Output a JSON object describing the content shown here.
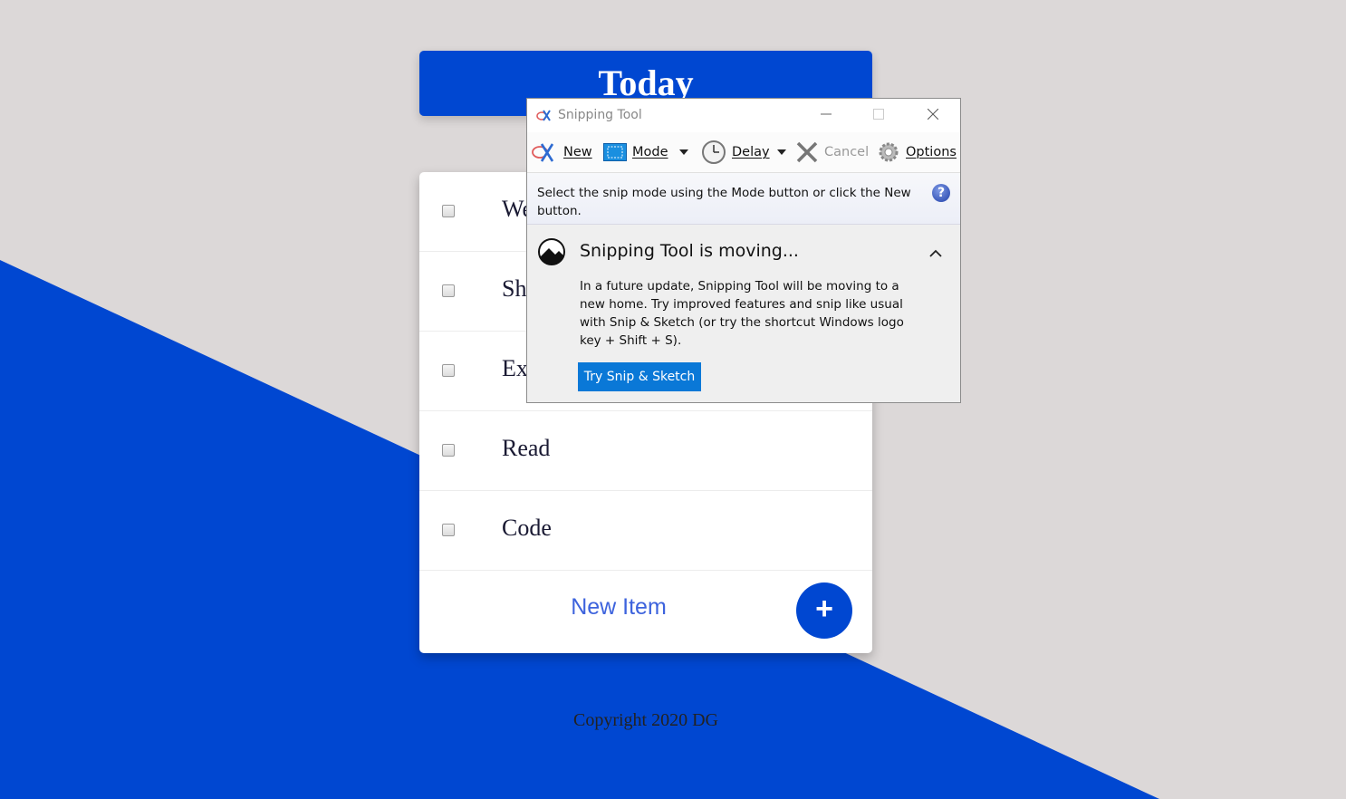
{
  "page": {
    "heading": "Today",
    "todo_items": [
      {
        "label": "We"
      },
      {
        "label": "Sho"
      },
      {
        "label": "Ex"
      },
      {
        "label": "Read"
      },
      {
        "label": "Code"
      }
    ],
    "new_item_label": "New Item",
    "add_button_symbol": "+",
    "copyright": "Copyright 2020 DG",
    "accent_color": "#0047d1",
    "background_color": "#dcd8d8"
  },
  "snipping_tool": {
    "window_title": "Snipping Tool",
    "toolbar": {
      "new_label": "New",
      "mode_label": "Mode",
      "delay_label": "Delay",
      "cancel_label": "Cancel",
      "options_label": "Options"
    },
    "instruction": "Select the snip mode using the Mode button or click the New button.",
    "notice": {
      "title": "Snipping Tool is moving...",
      "body": "In a future update, Snipping Tool will be moving to a new home. Try improved features and snip like usual with Snip & Sketch (or try the shortcut Windows logo key + Shift + S).",
      "button_label": "Try Snip & Sketch"
    },
    "icons": [
      "scissors-icon",
      "mode-rectangle-icon",
      "clock-icon",
      "cancel-x-icon",
      "gear-icon",
      "help-icon",
      "snip-sketch-icon",
      "chevron-up-icon"
    ]
  }
}
